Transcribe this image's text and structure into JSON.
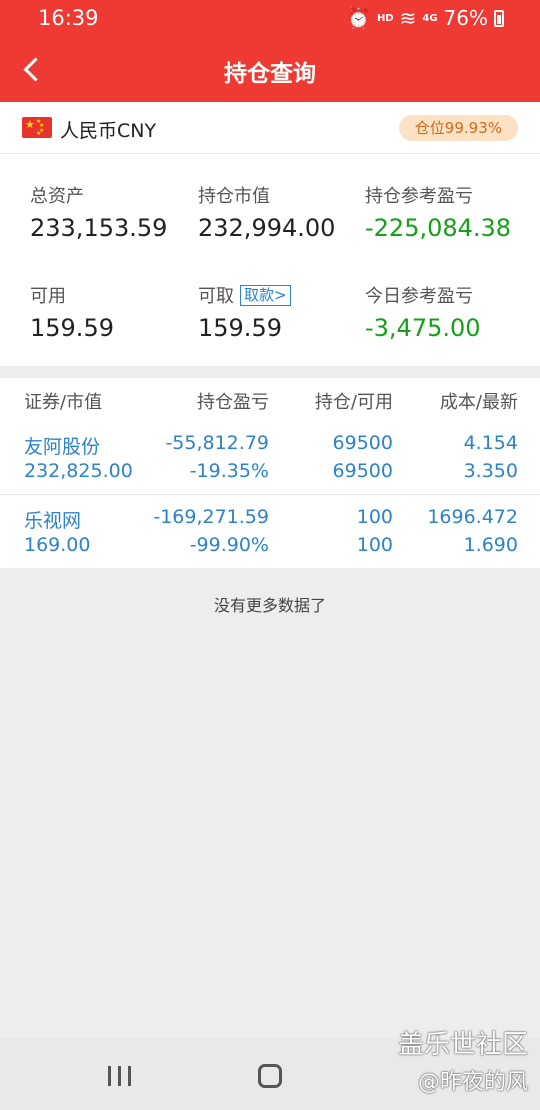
{
  "status_bar": {
    "time": "16:39",
    "hd": "HD",
    "network": "4G",
    "battery": "76%"
  },
  "header": {
    "title": "持仓查询"
  },
  "currency": {
    "name": "人民币CNY",
    "position_badge": "仓位99.93%"
  },
  "summary": {
    "total_assets": {
      "label": "总资产",
      "value": "233,153.59"
    },
    "market_value": {
      "label": "持仓市值",
      "value": "232,994.00"
    },
    "ref_pnl": {
      "label": "持仓参考盈亏",
      "value": "-225,084.38"
    },
    "available": {
      "label": "可用",
      "value": "159.59"
    },
    "withdrawable": {
      "label": "可取",
      "link": "取款>",
      "value": "159.59"
    },
    "today_pnl": {
      "label": "今日参考盈亏",
      "value": "-3,475.00"
    }
  },
  "table": {
    "headers": [
      "证券/市值",
      "持仓盈亏",
      "持仓/可用",
      "成本/最新"
    ],
    "rows": [
      {
        "name": "友阿股份",
        "market_value": "232,825.00",
        "pnl": "-55,812.79",
        "pnl_pct": "-19.35%",
        "position": "69500",
        "available": "69500",
        "cost": "4.154",
        "latest": "3.350"
      },
      {
        "name": "乐视网",
        "market_value": "169.00",
        "pnl": "-169,271.59",
        "pnl_pct": "-99.90%",
        "position": "100",
        "available": "100",
        "cost": "1696.472",
        "latest": "1.690"
      }
    ]
  },
  "footer_text": "没有更多数据了",
  "watermark": {
    "line1": "盖乐世社区",
    "line2": "@昨夜的风"
  },
  "colors": {
    "brand_red": "#ee3a33",
    "loss_green": "#16a017",
    "link_blue": "#2d83c8",
    "badge_bg": "#fde1c4",
    "badge_text": "#d26a1c"
  }
}
